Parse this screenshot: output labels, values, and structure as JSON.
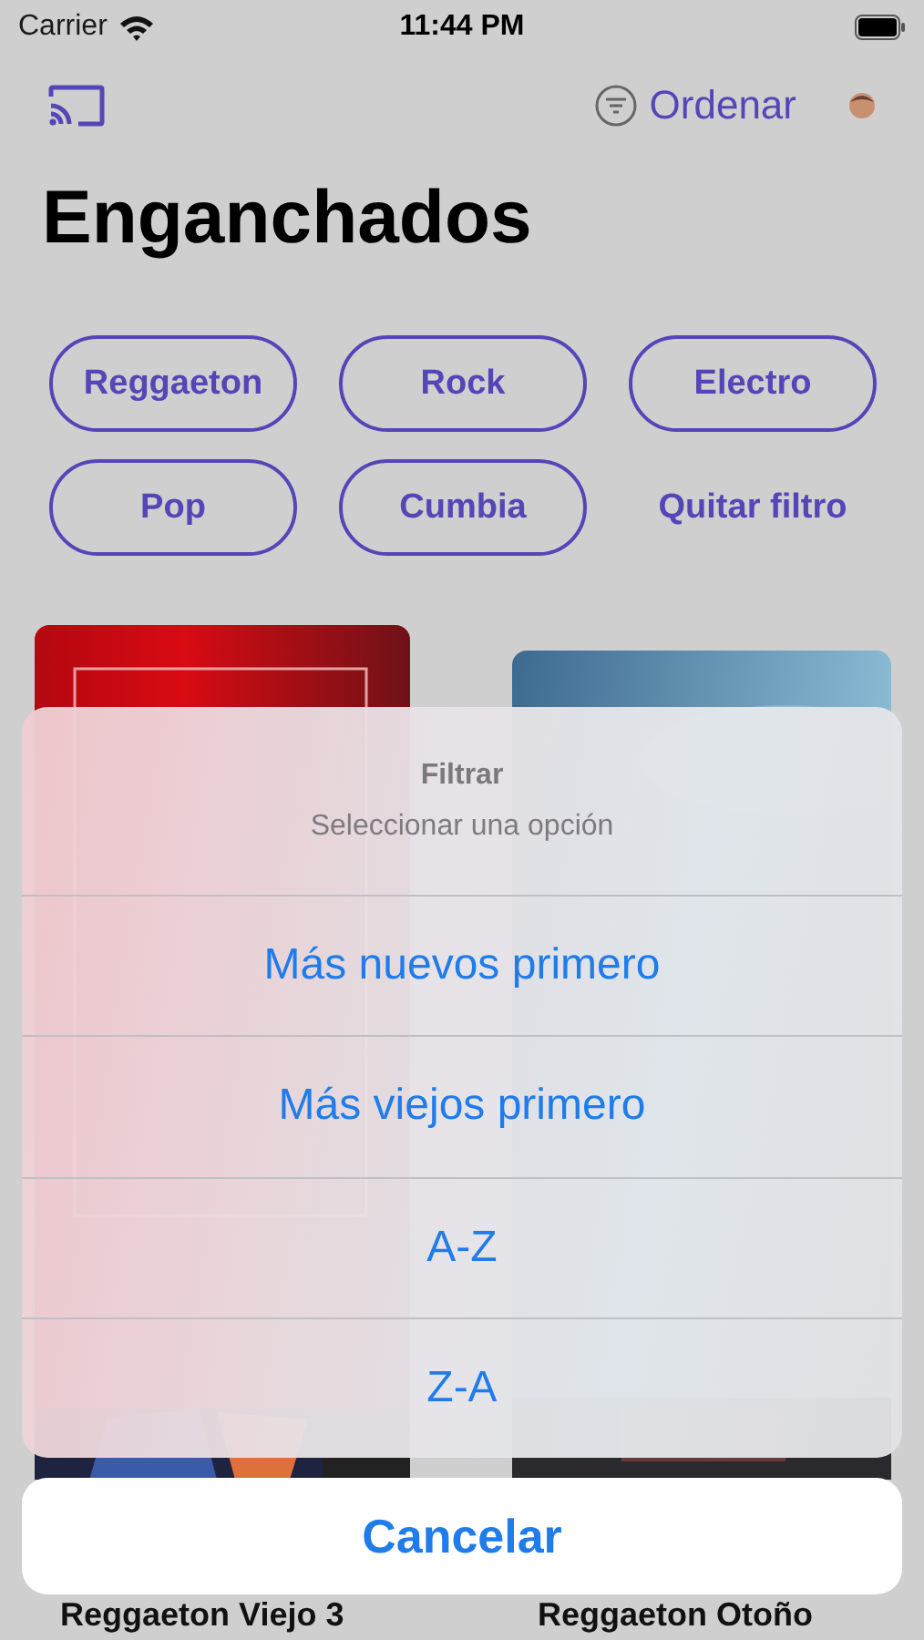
{
  "status_bar": {
    "carrier": "Carrier",
    "time": "11:44 PM"
  },
  "nav": {
    "sort_label": "Ordenar"
  },
  "title": "Enganchados",
  "filters": [
    {
      "label": "Reggaeton",
      "kind": "chip"
    },
    {
      "label": "Rock",
      "kind": "chip"
    },
    {
      "label": "Electro",
      "kind": "chip"
    },
    {
      "label": "Pop",
      "kind": "chip"
    },
    {
      "label": "Cumbia",
      "kind": "chip"
    },
    {
      "label": "Quitar filtro",
      "kind": "link"
    }
  ],
  "albums": [
    {
      "title": "Reggaeton Viejo 3",
      "kind": "picture"
    },
    {
      "title": "Reggaeton Otoño",
      "kind": "picture"
    }
  ],
  "action_sheet": {
    "title": "Filtrar",
    "message": "Seleccionar una opción",
    "options": [
      "Más nuevos primero",
      "Más viejos primero",
      "A-Z",
      "Z-A"
    ],
    "cancel": "Cancelar"
  }
}
